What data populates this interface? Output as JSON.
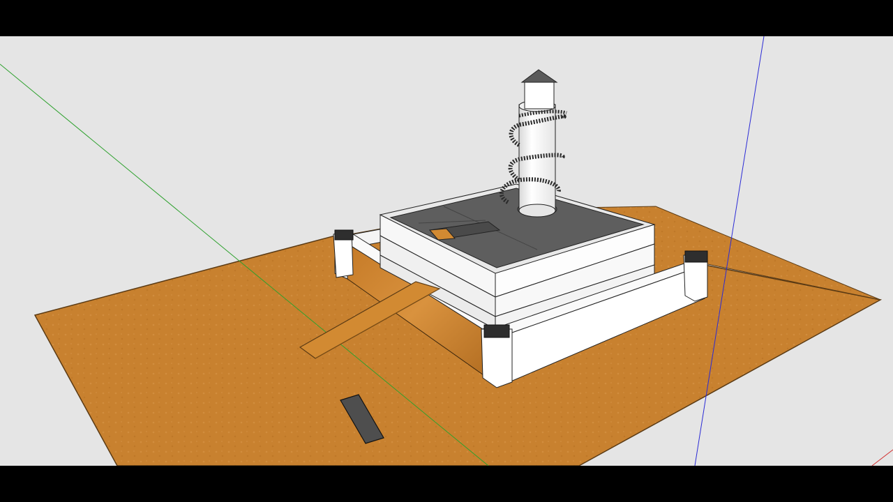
{
  "viewport": {
    "background_color": "#e5e5e5",
    "letterbox_color": "#000000"
  },
  "scene": {
    "ground_color": "#c8812f",
    "wall_color": "#ffffff",
    "roof_color": "#5e5e5e",
    "ramp_color": "#d28a32",
    "axis_colors": {
      "green_axis": "#2ea12e",
      "blue_axis": "#2b2bd6",
      "red_axis": "#d23030"
    }
  }
}
